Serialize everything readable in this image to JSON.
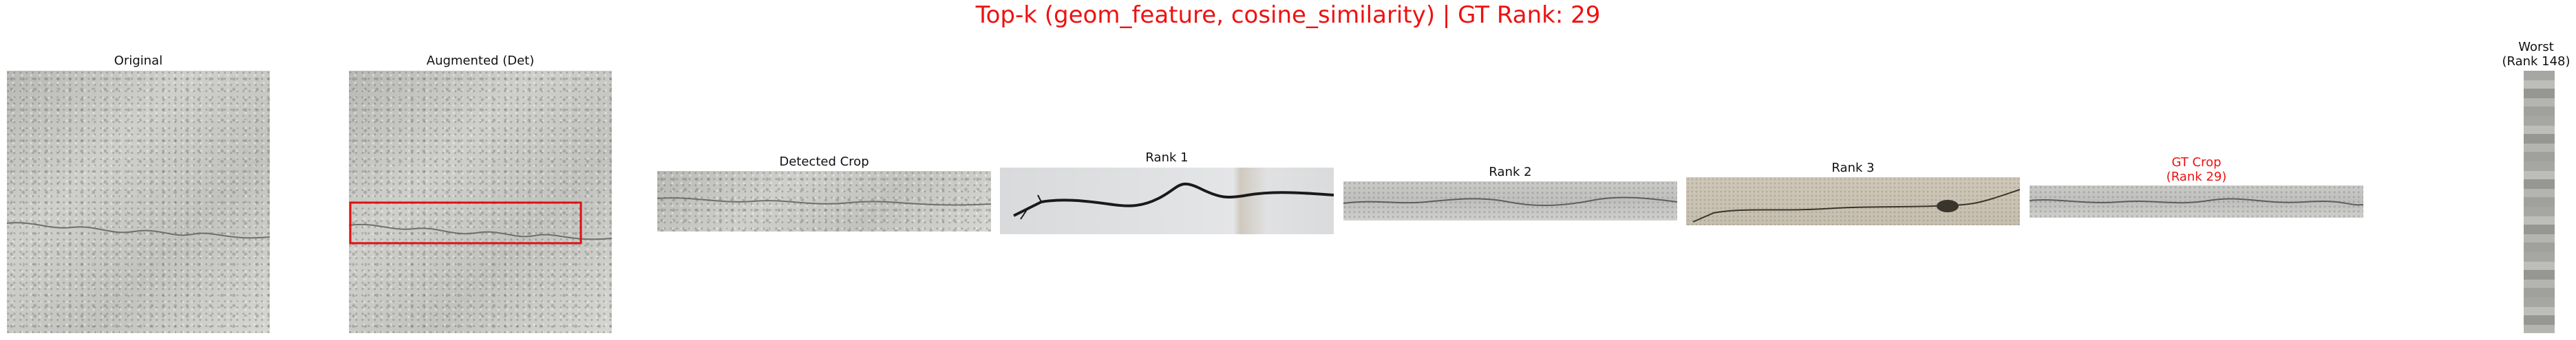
{
  "figure": {
    "title": "Top-k (geom_feature, cosine_similarity) | GT Rank: 29",
    "panels": {
      "original": {
        "label": "Original"
      },
      "augmented": {
        "label": "Augmented (Det)"
      },
      "detected": {
        "label": "Detected Crop"
      },
      "rank1": {
        "label": "Rank 1"
      },
      "rank2": {
        "label": "Rank 2"
      },
      "rank3": {
        "label": "Rank 3"
      },
      "gt": {
        "label_line1": "GT Crop",
        "label_line2": "(Rank 29)"
      },
      "worst": {
        "label_line1": "Worst",
        "label_line2": "(Rank 148)"
      }
    },
    "colors": {
      "title": "#ee1111",
      "gt_label": "#ee1111",
      "detection_box": "#dd1111"
    }
  }
}
